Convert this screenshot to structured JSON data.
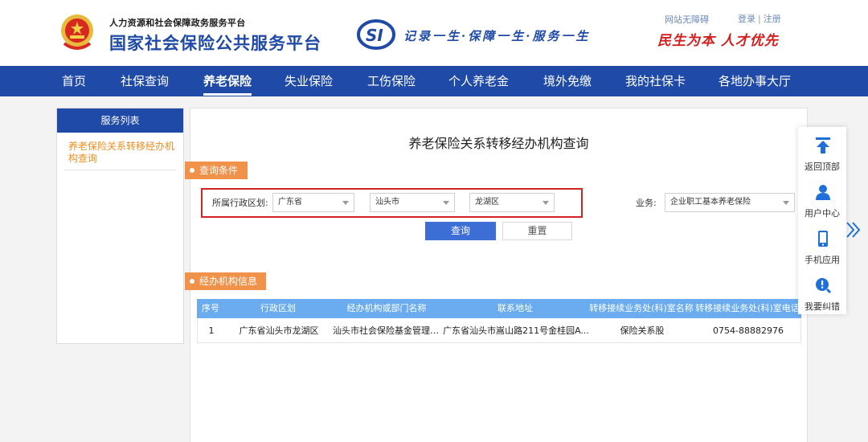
{
  "header": {
    "sub_title": "人力资源和社会保障政务服务平台",
    "title": "国家社会保险公共服务平台",
    "slogan": "记录一生·保障一生·服务一生",
    "slogan_red": "民生为本 人才优先",
    "accessibility": "网站无障碍",
    "login": "登录",
    "separator": "|",
    "register": "注册"
  },
  "nav": [
    {
      "label": "首页"
    },
    {
      "label": "社保查询"
    },
    {
      "label": "养老保险"
    },
    {
      "label": "失业保险"
    },
    {
      "label": "工伤保险"
    },
    {
      "label": "个人养老金"
    },
    {
      "label": "境外免缴"
    },
    {
      "label": "我的社保卡"
    },
    {
      "label": "各地办事大厅"
    }
  ],
  "sidebar": {
    "heading": "服务列表",
    "item": "养老保险关系转移经办机构查询"
  },
  "main": {
    "title": "养老保险关系转移经办机构查询",
    "query_tag": "查询条件",
    "region_label": "所属行政区划:",
    "province": "广东省",
    "city": "汕头市",
    "district": "龙湖区",
    "business_label": "业务:",
    "business": "企业职工基本养老保险",
    "query_button": "查询",
    "reset_button": "重置",
    "info_tag": "经办机构信息"
  },
  "table": {
    "headers": [
      "序号",
      "行政区划",
      "经办机构或部门名称",
      "联系地址",
      "转移接续业务处(科)室名称",
      "转移接续业务处(科)室电话"
    ],
    "rows": [
      [
        "1",
        "广东省汕头市龙湖区",
        "汕头市社会保险基金管理局...",
        "广东省汕头市嵩山路211号金桂园A...",
        "保险关系股",
        "0754-88882976"
      ]
    ]
  },
  "float_bar": [
    {
      "label": "返回顶部",
      "icon": "arrow-up-icon"
    },
    {
      "label": "用户中心",
      "icon": "user-icon"
    },
    {
      "label": "手机应用",
      "icon": "phone-icon"
    },
    {
      "label": "我要纠错",
      "icon": "error-icon"
    }
  ],
  "colors": {
    "brand_blue": "#1f4aa8",
    "accent_orange": "#f0924a",
    "table_header": "#6aacef",
    "highlight_red": "#d32323"
  }
}
